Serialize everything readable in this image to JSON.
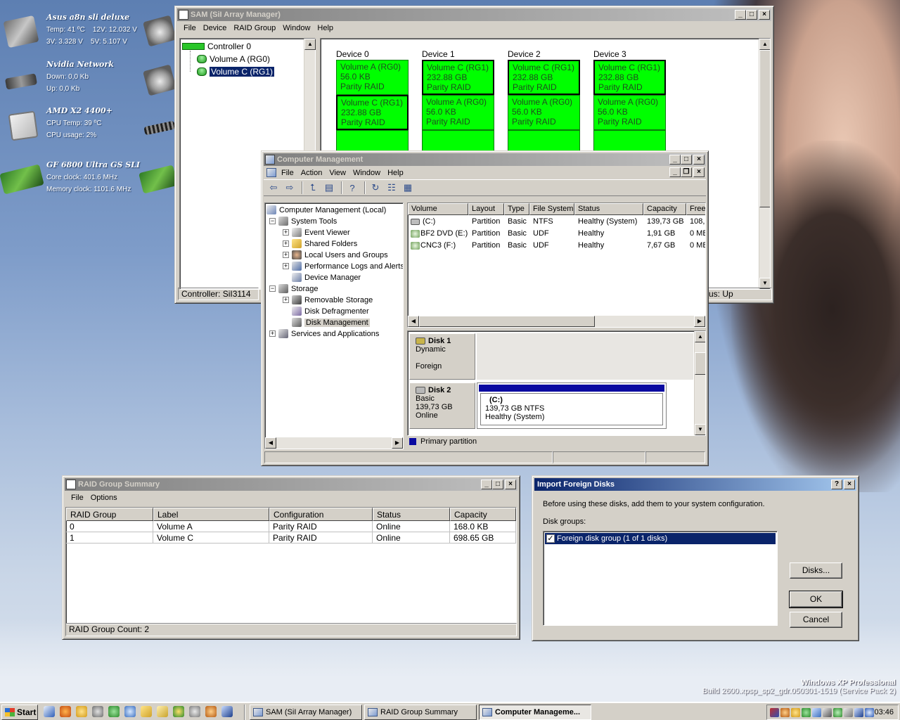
{
  "colors": {
    "active_title": "#0a246a",
    "volume_fill": "#00ff00",
    "desktop": "#7e9cc9"
  },
  "gadgets": [
    {
      "title": "Asus a8n sli deluxe",
      "lines": [
        "Temp: 41 ºC    12V: 12.032 V",
        "3V: 3.328 V    5V: 5.107 V"
      ]
    },
    {
      "title": "Nvidia Network",
      "lines": [
        "Down: 0,0 Kb",
        "Up: 0,0 Kb"
      ]
    },
    {
      "title": "AMD X2 4400+",
      "lines": [
        "CPU Temp: 39 ºC",
        "CPU usage: 2%"
      ]
    },
    {
      "title": "GF 6800 Ultra GS SLI",
      "lines": [
        "Core clock: 401.6 MHz",
        "Memory clock: 1101.6 MHz"
      ]
    }
  ],
  "sam": {
    "title": "SAM (SiI Array Manager)",
    "menu": [
      "File",
      "Device",
      "RAID Group",
      "Window",
      "Help"
    ],
    "tree": {
      "controller": "Controller 0",
      "volumes": [
        "Volume A (RG0)",
        "Volume C (RG1)"
      ]
    },
    "devices": [
      {
        "label": "Device 0",
        "blocks": [
          {
            "lines": [
              "Volume A (RG0)",
              "56.0 KB",
              "Parity RAID"
            ]
          },
          {
            "lines": [
              "Volume C (RG1)",
              "232.88 GB",
              "Parity RAID"
            ]
          }
        ]
      },
      {
        "label": "Device 1",
        "blocks": [
          {
            "lines": [
              "Volume C (RG1)",
              "232.88 GB",
              "Parity RAID"
            ]
          },
          {
            "lines": [
              "Volume A (RG0)",
              "56.0 KB",
              "Parity RAID"
            ]
          }
        ]
      },
      {
        "label": "Device 2",
        "blocks": [
          {
            "lines": [
              "Volume C (RG1)",
              "232.88 GB",
              "Parity RAID"
            ]
          },
          {
            "lines": [
              "Volume A (RG0)",
              "56.0 KB",
              "Parity RAID"
            ]
          }
        ]
      },
      {
        "label": "Device 3",
        "blocks": [
          {
            "lines": [
              "Volume C (RG1)",
              "232.88 GB",
              "Parity RAID"
            ]
          },
          {
            "lines": [
              "Volume A (RG0)",
              "56.0 KB",
              "Parity RAID"
            ]
          }
        ]
      }
    ],
    "status_left": "Controller: SiI3114",
    "status_right": "us: Up"
  },
  "cm": {
    "title": "Computer Management",
    "menu": [
      "File",
      "Action",
      "View",
      "Window",
      "Help"
    ],
    "tree": {
      "root": "Computer Management (Local)",
      "system_tools": "System Tools",
      "event_viewer": "Event Viewer",
      "shared_folders": "Shared Folders",
      "local_users": "Local Users and Groups",
      "perf_logs": "Performance Logs and Alerts",
      "device_manager": "Device Manager",
      "storage": "Storage",
      "removable": "Removable Storage",
      "defrag": "Disk Defragmenter",
      "disk_mgmt": "Disk Management",
      "services": "Services and Applications"
    },
    "columns": [
      "Volume",
      "Layout",
      "Type",
      "File System",
      "Status",
      "Capacity",
      "Free"
    ],
    "rows": [
      [
        "(C:)",
        "Partition",
        "Basic",
        "NTFS",
        "Healthy (System)",
        "139,73 GB",
        "108,"
      ],
      [
        "BF2 DVD (E:)",
        "Partition",
        "Basic",
        "UDF",
        "Healthy",
        "1,91 GB",
        "0 MB"
      ],
      [
        "CNC3 (F:)",
        "Partition",
        "Basic",
        "UDF",
        "Healthy",
        "7,67 GB",
        "0 MB"
      ]
    ],
    "disk1": {
      "name": "Disk 1",
      "type": "Dynamic",
      "state": "Foreign"
    },
    "disk2": {
      "name": "Disk 2",
      "type": "Basic",
      "size": "139,73 GB",
      "state": "Online",
      "partition": {
        "name": "(C:)",
        "size": "139,73 GB NTFS",
        "status": "Healthy (System)"
      }
    },
    "legend": "Primary partition"
  },
  "rgs": {
    "title": "RAID Group Summary",
    "menu": [
      "File",
      "Options"
    ],
    "columns": [
      "RAID Group",
      "Label",
      "Configuration",
      "Status",
      "Capacity"
    ],
    "rows": [
      [
        "0",
        "Volume A",
        "Parity RAID",
        "Online",
        "168.0 KB"
      ],
      [
        "1",
        "Volume C",
        "Parity RAID",
        "Online",
        "698.65 GB"
      ]
    ],
    "status": "RAID Group Count: 2"
  },
  "ifd": {
    "title": "Import Foreign Disks",
    "help": "?",
    "instruction": "Before using these disks, add them to your system configuration.",
    "groups_label": "Disk groups:",
    "group_item": "Foreign disk group (1 of 1 disks)",
    "group_checked": true,
    "disks_button": "Disks...",
    "ok_button": "OK",
    "cancel_button": "Cancel"
  },
  "watermark": {
    "line1": "Windows XP Professional",
    "line2": "Build 2600.xpsp_sp2_gdr.050301-1519 (Service Pack 2)"
  },
  "taskbar": {
    "start": "Start",
    "tasks": [
      "SAM (SiI Array Manager)",
      "RAID Group Summary",
      "Computer Manageme..."
    ],
    "clock": "03:46"
  }
}
